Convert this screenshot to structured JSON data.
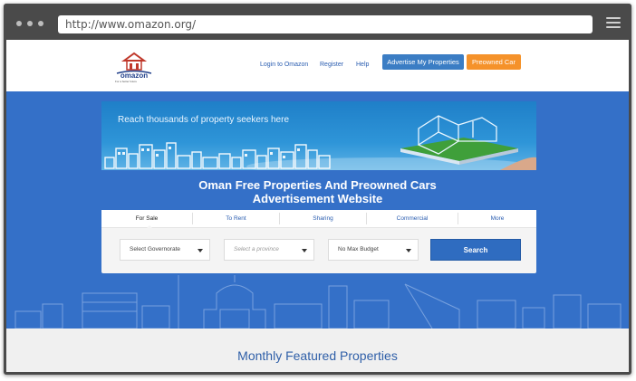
{
  "browser": {
    "url": "http://www.omazon.org/"
  },
  "site": {
    "logo_text": "omazon",
    "logo_tagline": "For a better future",
    "nav": {
      "login": "Login to Omazon",
      "register": "Register",
      "help": "Help"
    },
    "buttons": {
      "advertise": "Advertise My Properties",
      "preowned": "Preowned Car"
    }
  },
  "hero": {
    "banner_text": "Reach thousands of property seekers here",
    "title_line1": "Oman Free Properties And Preowned Cars",
    "title_line2": "Advertisement Website"
  },
  "search": {
    "tabs": [
      "For Sale",
      "To Rent",
      "Sharing",
      "Commercial",
      "More"
    ],
    "active_tab": "For Sale",
    "governorate": "Select Governorate",
    "province": "Select a province",
    "budget": "No Max Budget",
    "button": "Search"
  },
  "featured": {
    "title": "Monthly Featured Properties"
  },
  "colors": {
    "hero_bg": "#3470c8",
    "advertise_btn": "#3b7dc4",
    "preowned_btn": "#f5922a",
    "search_btn": "#2f6cc0",
    "link": "#2a5db0"
  }
}
